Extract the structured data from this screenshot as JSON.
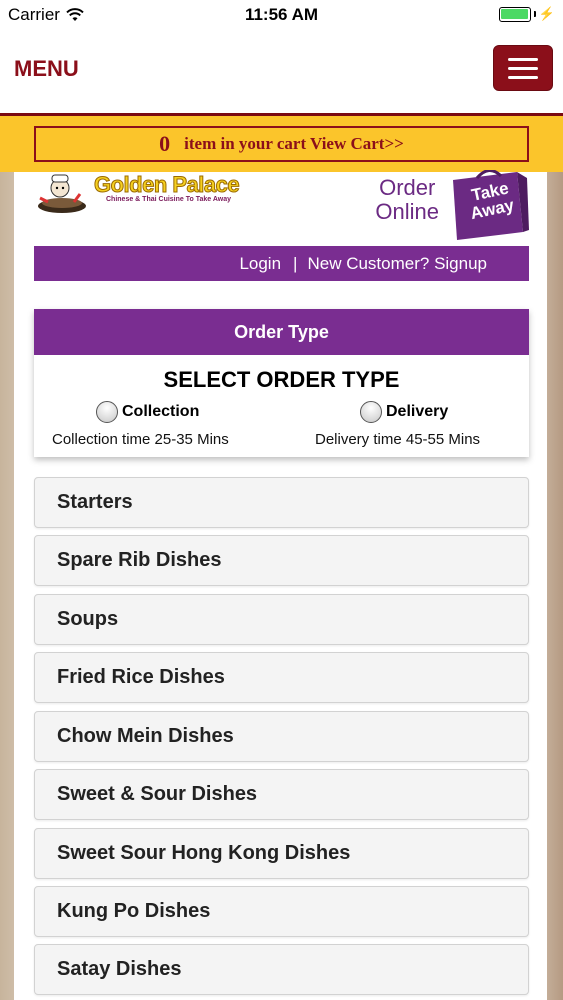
{
  "status_bar": {
    "carrier": "Carrier",
    "time": "11:56 AM",
    "battery_level": 1.0
  },
  "header": {
    "menu_label": "MENU"
  },
  "cart": {
    "count": "0",
    "text": "item in your cart View Cart>>"
  },
  "brand": {
    "name": "Golden Palace",
    "tagline": "Chinese & Thai Cuisine To Take Away",
    "order_online_line1": "Order",
    "order_online_line2": "Online",
    "bag_line1": "Take",
    "bag_line2": "Away"
  },
  "auth": {
    "login": "Login",
    "separator": "|",
    "signup": "New Customer? Signup"
  },
  "order_type": {
    "header": "Order Type",
    "title": "SELECT ORDER TYPE",
    "collection_label": "Collection",
    "collection_time": "Collection time 25-35 Mins",
    "delivery_label": "Delivery",
    "delivery_time": "Delivery time 45-55 Mins"
  },
  "categories": [
    "Starters",
    "Spare Rib Dishes",
    "Soups",
    "Fried Rice Dishes",
    "Chow Mein Dishes",
    "Sweet & Sour Dishes",
    "Sweet Sour Hong Kong Dishes",
    "Kung Po Dishes",
    "Satay Dishes"
  ],
  "colors": {
    "brand_red": "#8b0f1a",
    "brand_purple": "#7a2d91",
    "cart_yellow": "#fbc52b",
    "battery_green": "#4cd964"
  }
}
